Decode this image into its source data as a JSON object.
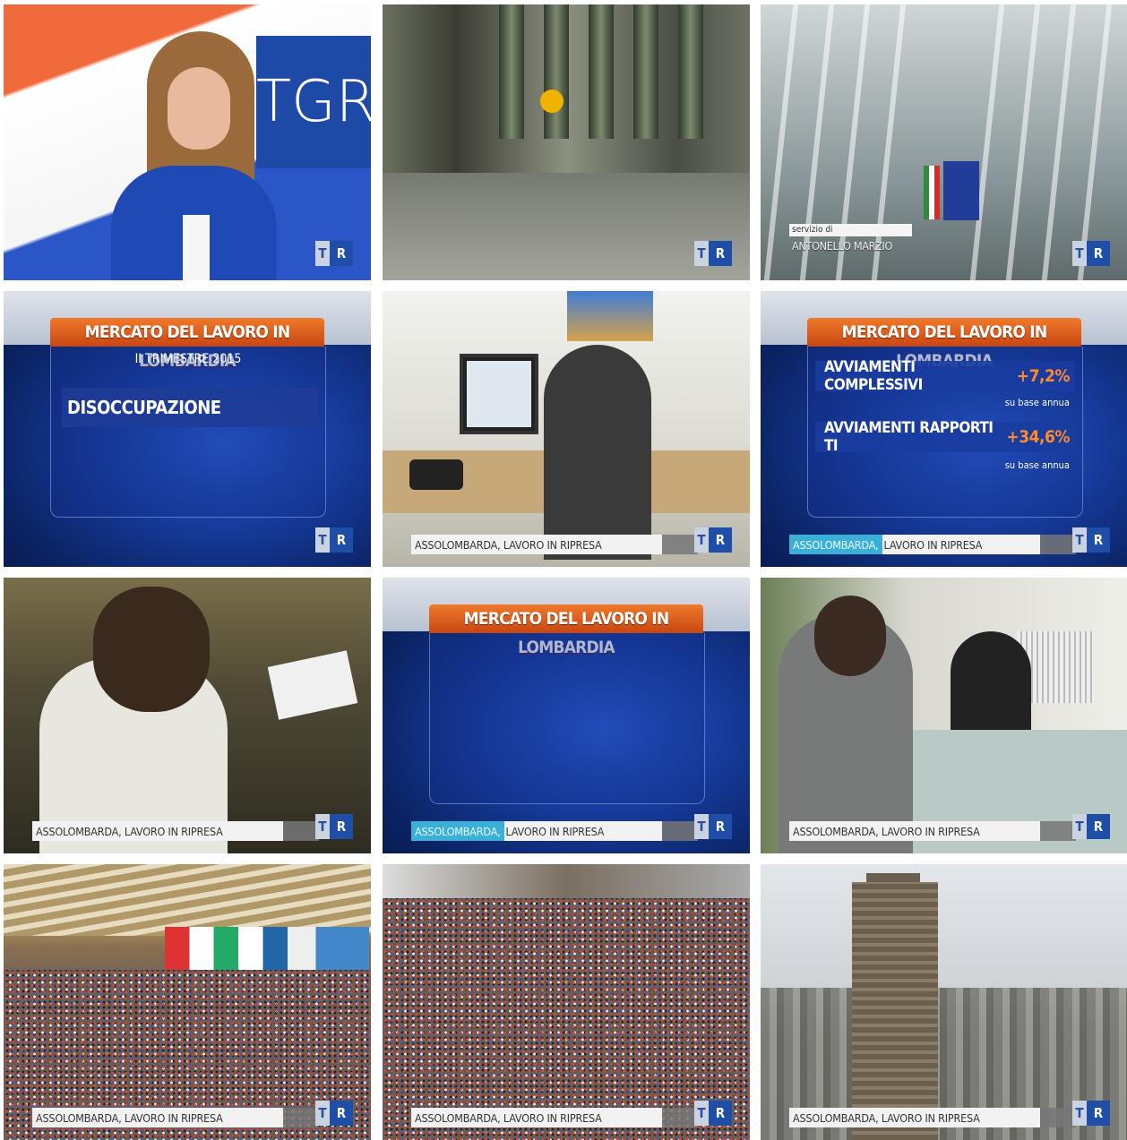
{
  "logo": {
    "part1": "T",
    "part2": "R"
  },
  "studio": {
    "brand": "TGR"
  },
  "byline": {
    "label": "servizio di",
    "name": "ANTONELLO MARZIO"
  },
  "caption": {
    "full": "ASSOLOMBARDA, LAVORO IN RIPRESA",
    "highlight": "ASSOLOMBARDA,",
    "rest": "LAVORO IN RIPRESA"
  },
  "infographic": {
    "title": "MERCATO DEL LAVORO IN LOMBARDIA",
    "period": "II TRIMESTRE 2015",
    "topic": "DISOCCUPAZIONE",
    "stats": [
      {
        "label": "AVVIAMENTI COMPLESSIVI",
        "value": "+7,2%",
        "note": "su base annua"
      },
      {
        "label": "AVVIAMENTI RAPPORTI TI",
        "value": "+34,6%",
        "note": "su base annua"
      }
    ]
  },
  "colors": {
    "tgr_blue": "#1e4ea8",
    "title_orange": "#e2621f",
    "highlight_cyan": "#3ab0d8",
    "stat_orange": "#ff8a2a"
  }
}
